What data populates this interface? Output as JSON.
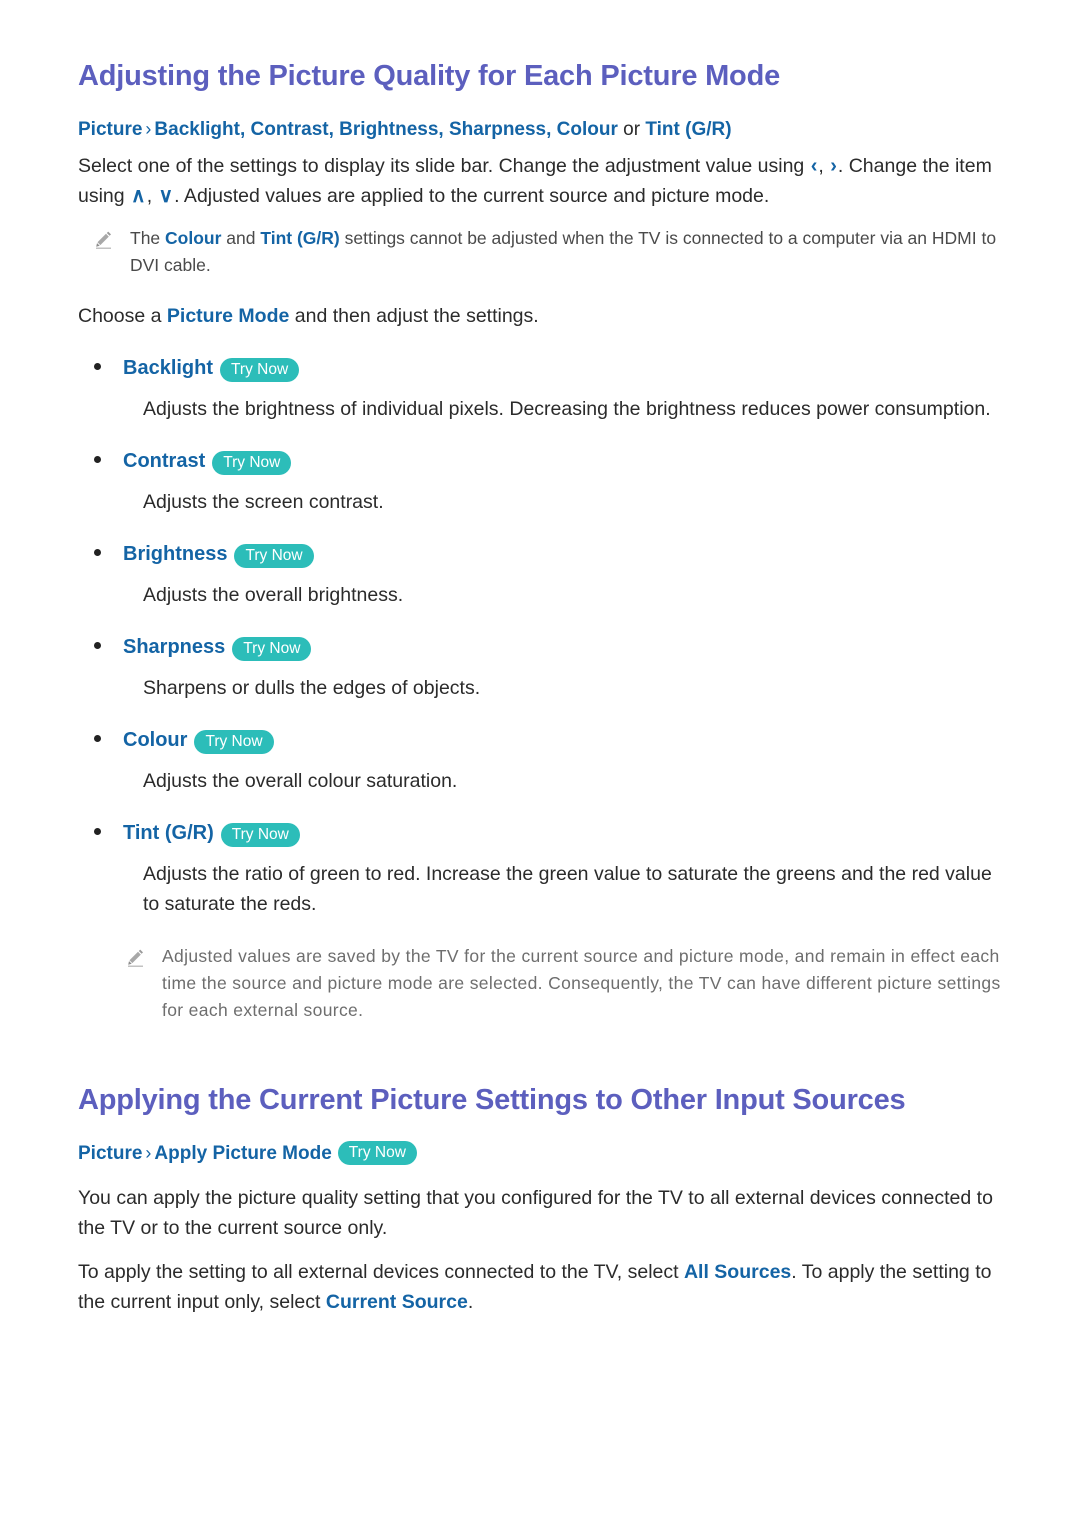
{
  "document": {
    "section1": {
      "title": "Adjusting the Picture Quality for Each Picture Mode",
      "breadcrumb": {
        "root": "Picture",
        "separator": "›",
        "items": "Backlight, Contrast, Brightness, Sharpness, Colour",
        "conjunction": "or",
        "last": "Tint (G/R)"
      },
      "intro": {
        "part1": "Select one of the settings to display its slide bar. Change the adjustment value using ",
        "arrow_left": "‹",
        "arrow_comma": ", ",
        "arrow_right": "›",
        "part2": ". Change the item using ",
        "arrow_up": "∧",
        "arrow_down": "∨",
        "part3": ". Adjusted values are applied to the current source and picture mode."
      },
      "note1": {
        "icon": "pencil-icon",
        "text_part1": "The ",
        "hl1": "Colour",
        "text_part2": " and ",
        "hl2": "Tint (G/R)",
        "text_part3": " settings cannot be adjusted when the TV is connected to a computer via an HDMI to DVI cable."
      },
      "choose_line": {
        "part1": "Choose a ",
        "hl": "Picture Mode",
        "part2": " and then adjust the settings."
      },
      "badge_label": "Try Now",
      "settings": [
        {
          "label": "Backlight",
          "badge": "Try Now",
          "description": "Adjusts the brightness of individual pixels. Decreasing the brightness reduces power consumption."
        },
        {
          "label": "Contrast",
          "badge": "Try Now",
          "description": "Adjusts the screen contrast."
        },
        {
          "label": "Brightness",
          "badge": "Try Now",
          "description": "Adjusts the overall brightness."
        },
        {
          "label": "Sharpness",
          "badge": "Try Now",
          "description": "Sharpens or dulls the edges of objects."
        },
        {
          "label": "Colour",
          "badge": "Try Now",
          "description": "Adjusts the overall colour saturation."
        },
        {
          "label": "Tint (G/R)",
          "badge": "Try Now",
          "description": "Adjusts the ratio of green to red. Increase the green value to saturate the greens and the red value to saturate the reds."
        }
      ],
      "note2": {
        "icon": "pencil-icon",
        "text": "Adjusted values are saved by the TV for the current source and picture mode, and remain in effect each time the source and picture mode are selected. Consequently, the TV can have different picture settings for each external source."
      }
    },
    "section2": {
      "title": "Applying the Current Picture Settings to Other Input Sources",
      "breadcrumb": {
        "root": "Picture",
        "separator": "›",
        "item": "Apply Picture Mode",
        "badge": "Try Now"
      },
      "paragraph1": "You can apply the picture quality setting that you configured for the TV to all external devices connected to the TV or to the current source only.",
      "paragraph2": {
        "part1": "To apply the setting to all external devices connected to the TV, select ",
        "hl1": "All Sources",
        "part2": ". To apply the setting to the current input only, select ",
        "hl2": "Current Source",
        "part3": "."
      }
    },
    "colors": {
      "heading": "#5C5FBE",
      "link": "#1464A5",
      "badge_bg": "#2CBDB9",
      "body_text": "#2B2B2B",
      "note_text": "#6E6E6E"
    }
  }
}
